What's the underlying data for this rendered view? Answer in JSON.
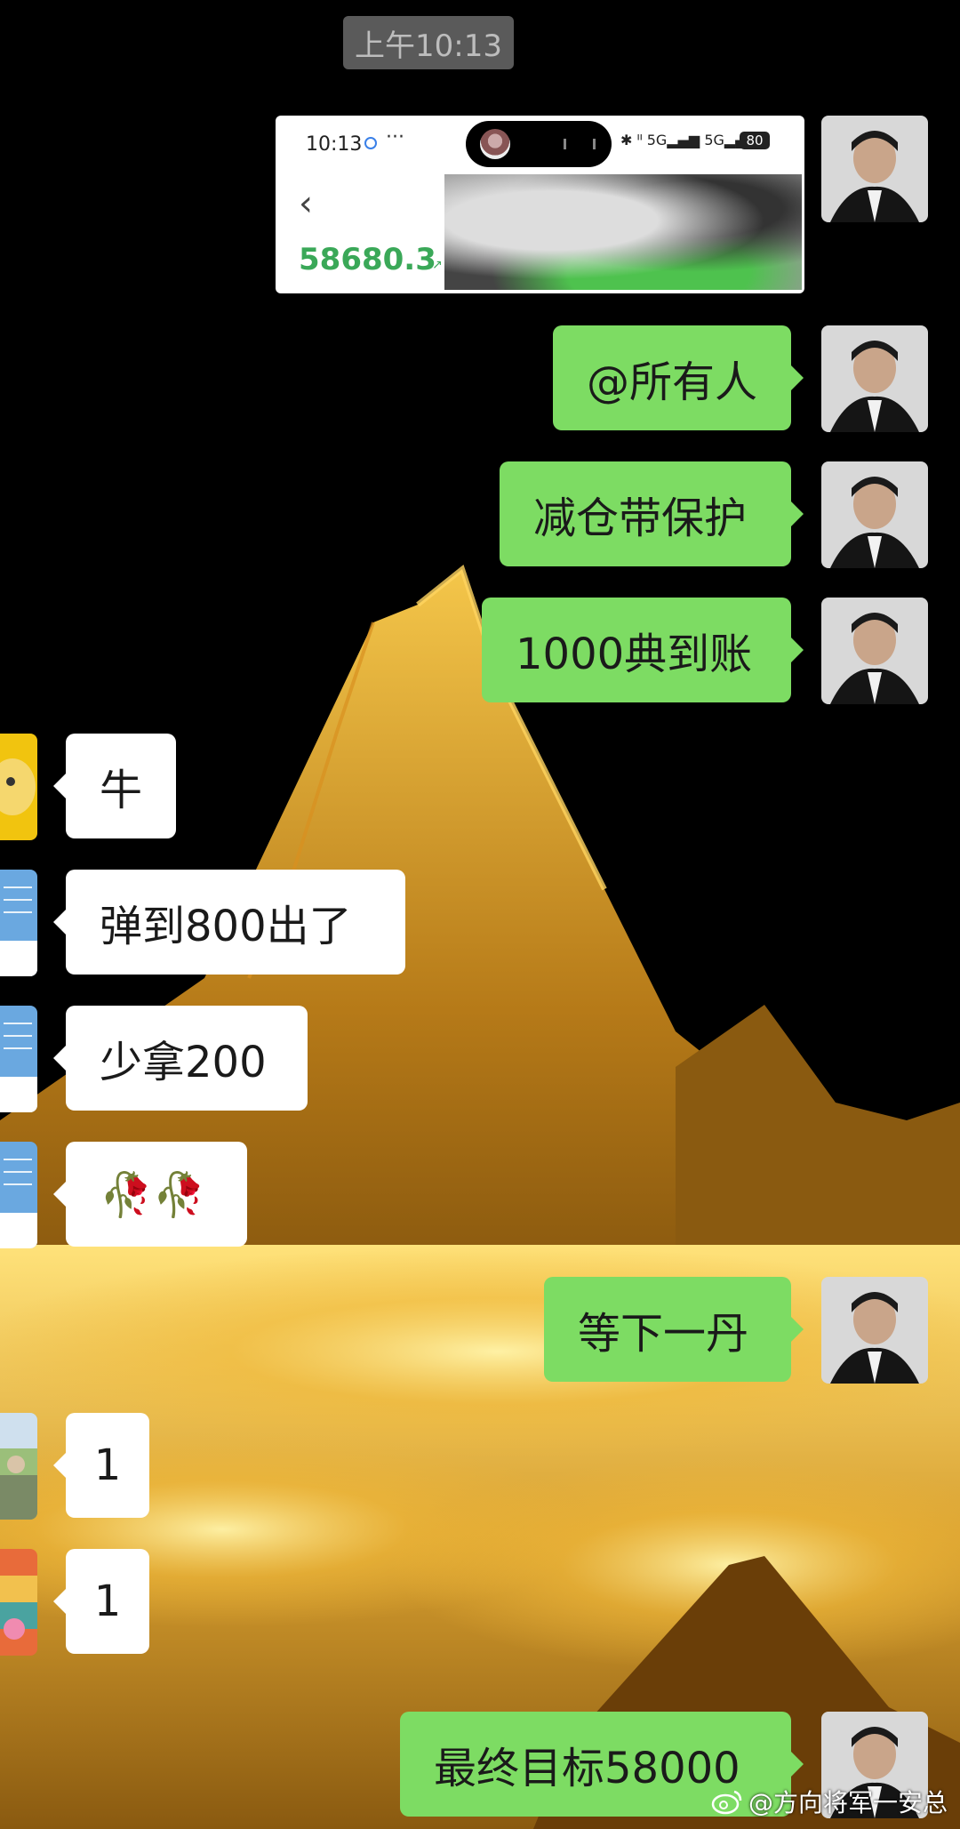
{
  "timestamp": "上午10:13",
  "screenshot_card": {
    "status_time": "10:13",
    "status_more": "···",
    "network_label": "5G",
    "battery": "80",
    "back_icon": "chevron-left-icon",
    "amount": "58680.3"
  },
  "messages": [
    {
      "side": "right",
      "text": "@所有人"
    },
    {
      "side": "right",
      "text": "减仓带保护"
    },
    {
      "side": "right",
      "text": "1000典到账"
    },
    {
      "side": "left",
      "text": "牛"
    },
    {
      "side": "left",
      "text": "弹到800出了"
    },
    {
      "side": "left",
      "text": "少拿200"
    },
    {
      "side": "left",
      "text": "🥀🥀"
    },
    {
      "side": "right",
      "text": "等下一丹"
    },
    {
      "side": "left",
      "text": "1"
    },
    {
      "side": "left",
      "text": "1"
    },
    {
      "side": "right",
      "text": "最终目标58000"
    }
  ],
  "watermark": "@方向将军一安总",
  "colors": {
    "sent_bubble": "#7ddc63",
    "received_bubble": "#ffffff",
    "amount_green": "#3aa858",
    "timestamp_bg": "#5a5a5a"
  }
}
